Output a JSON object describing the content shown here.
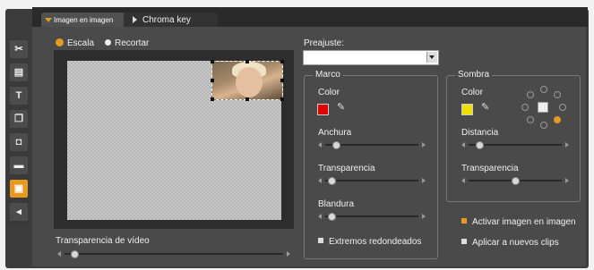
{
  "tabs": [
    {
      "label": "Imagen en imagen",
      "active": true
    },
    {
      "label": "Chroma key",
      "active": false
    }
  ],
  "sidebar": {
    "tools": [
      {
        "icon": "scissors-icon",
        "glyph": "✂"
      },
      {
        "icon": "title-icon",
        "glyph": "▤"
      },
      {
        "icon": "text-icon",
        "glyph": "T"
      },
      {
        "icon": "copy-icon",
        "glyph": "❐"
      },
      {
        "icon": "camera-icon",
        "glyph": "◘"
      },
      {
        "icon": "clapper-icon",
        "glyph": "▬"
      },
      {
        "icon": "pip-icon",
        "glyph": "▣",
        "active": true
      },
      {
        "icon": "speaker-icon",
        "glyph": "◂"
      }
    ]
  },
  "mode": {
    "scale_label": "Escala",
    "crop_label": "Recortar",
    "selected": "Escala"
  },
  "preset": {
    "label": "Preajuste:",
    "value": ""
  },
  "video_transparency": {
    "label": "Transparencia de vídeo",
    "value": 0.03
  },
  "border_group": {
    "title": "Marco",
    "color_label": "Color",
    "color": "#e00000",
    "width_label": "Anchura",
    "width_value": 0.08,
    "transparency_label": "Transparencia",
    "transparency_value": 0.03,
    "softness_label": "Blandura",
    "softness_value": 0.03,
    "rounded_label": "Extremos redondeados",
    "rounded_checked": false
  },
  "shadow_group": {
    "title": "Sombra",
    "color_label": "Color",
    "color": "#f0e000",
    "distance_label": "Distancia",
    "distance_value": 0.08,
    "transparency_label": "Transparencia",
    "transparency_value": 0.5,
    "direction": "bottom-right"
  },
  "options": {
    "activate_label": "Activar imagen en imagen",
    "activate_checked": true,
    "apply_label": "Aplicar a nuevos clips",
    "apply_checked": false
  },
  "colors": {
    "accent": "#e79a21",
    "panel": "#4a4a4a"
  }
}
